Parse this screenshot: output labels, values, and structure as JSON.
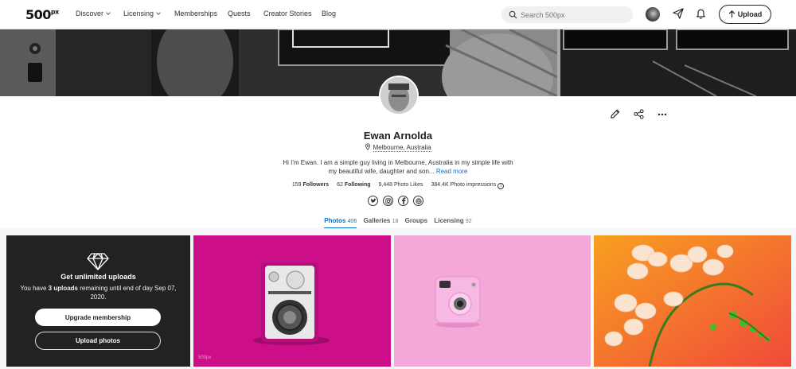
{
  "nav": {
    "logo": "500",
    "logo_sup": "px",
    "discover": "Discover",
    "licensing": "Licensing",
    "memberships": "Memberships",
    "quests": "Quests",
    "creator_stories": "Creator Stories",
    "blog": "Blog",
    "search_placeholder": "Search 500px",
    "upload": "Upload"
  },
  "profile": {
    "name": "Ewan Arnolda",
    "location": "Melbourne, Australia",
    "bio": "Hi I'm Ewan. I am a simple guy living in Melbourne, Australia in my simple life with my beautiful wife, daughter and son...",
    "read_more": "Read more",
    "followers_count": "159",
    "followers_label": "Followers",
    "following_count": "62",
    "following_label": "Following",
    "likes": "9,448 Photo Likes",
    "impressions": "384.4K Photo impressions",
    "info_glyph": "i"
  },
  "tabs": [
    {
      "label": "Photos",
      "count": "406"
    },
    {
      "label": "Galleries",
      "count": "18"
    },
    {
      "label": "Groups",
      "count": ""
    },
    {
      "label": "Licensing",
      "count": "92"
    }
  ],
  "promo": {
    "title": "Get unlimited uploads",
    "text_pre": "You have ",
    "text_bold": "3 uploads",
    "text_post": " remaining until end of day Sep 07, 2020.",
    "upgrade": "Upgrade membership",
    "upload_photos": "Upload photos"
  },
  "watermark": "500px",
  "colors": {
    "accent": "#0870d1",
    "magenta": "#cc0f88",
    "pink": "#f4a8d9",
    "orange": "#f36b2f"
  }
}
